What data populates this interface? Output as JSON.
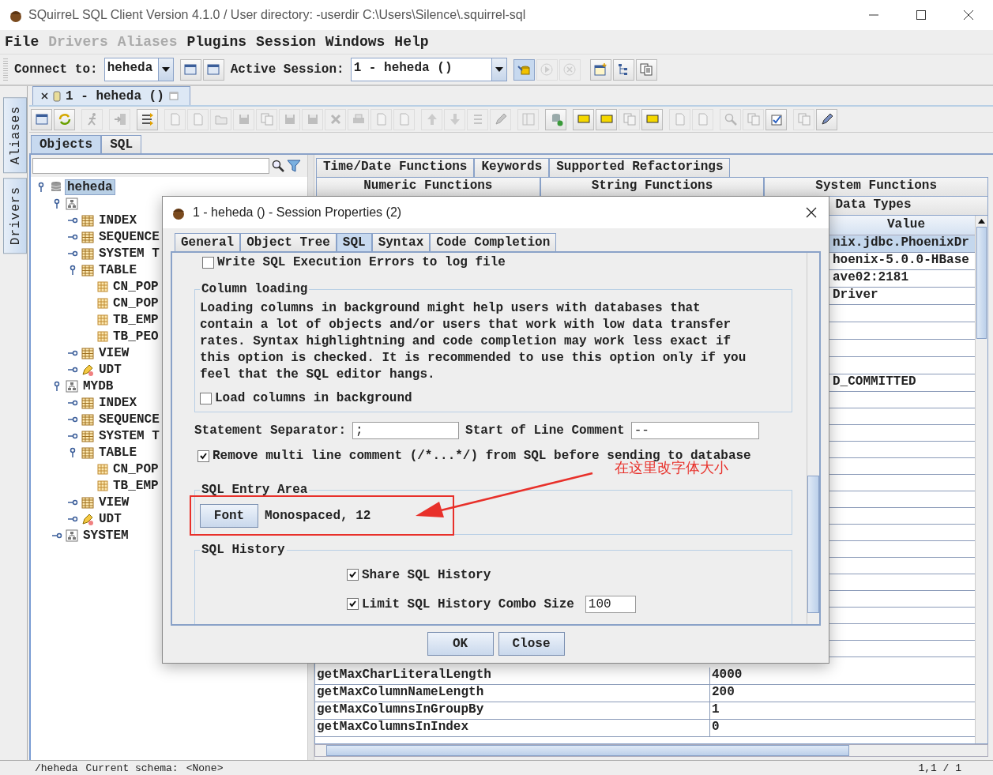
{
  "window": {
    "title": "SQuirreL SQL Client Version 4.1.0 / User directory: -userdir C:\\Users\\Silence\\.squirrel-sql"
  },
  "menu": [
    {
      "label": "File",
      "disabled": false
    },
    {
      "label": "Drivers",
      "disabled": true
    },
    {
      "label": "Aliases",
      "disabled": true
    },
    {
      "label": "Plugins",
      "disabled": false
    },
    {
      "label": "Session",
      "disabled": false
    },
    {
      "label": "Windows",
      "disabled": false
    },
    {
      "label": "Help",
      "disabled": false
    }
  ],
  "toolbar": {
    "connect_label": "Connect to:",
    "connect_value": "heheda",
    "connect_buttons": [
      {
        "disabled": false
      },
      {
        "disabled": false
      }
    ],
    "session_label": "Active Session:",
    "session_value": "1 - heheda ()",
    "session_buttons": [
      {
        "disabled": false
      },
      {
        "disabled": true
      },
      {
        "disabled": true
      },
      {
        "disabled": false
      },
      {
        "disabled": false
      },
      {
        "disabled": false
      }
    ]
  },
  "side_tabs": [
    {
      "label": "Aliases"
    },
    {
      "label": "Drivers"
    }
  ],
  "session_tab": {
    "label": "1 - heheda ()"
  },
  "session_toolbar": [
    [
      {
        "disabled": false
      },
      {
        "disabled": false
      }
    ],
    [
      {
        "disabled": true
      }
    ],
    [
      {
        "disabled": true
      }
    ],
    [
      {
        "disabled": false
      }
    ],
    [
      {
        "disabled": true
      },
      {
        "disabled": true
      },
      {
        "disabled": true
      },
      {
        "disabled": true
      },
      {
        "disabled": true
      },
      {
        "disabled": true
      },
      {
        "disabled": true
      },
      {
        "disabled": true
      },
      {
        "disabled": true
      },
      {
        "disabled": true
      },
      {
        "disabled": true
      }
    ],
    [
      {
        "disabled": true
      },
      {
        "disabled": true
      },
      {
        "disabled": true
      },
      {
        "disabled": true
      }
    ],
    [
      {
        "disabled": true
      }
    ],
    [
      {
        "disabled": false
      }
    ],
    [
      {
        "disabled": false
      },
      {
        "disabled": false
      },
      {
        "disabled": true
      },
      {
        "disabled": false
      }
    ],
    [
      {
        "disabled": true
      },
      {
        "disabled": true
      }
    ],
    [
      {
        "disabled": true
      },
      {
        "disabled": true
      },
      {
        "disabled": false
      }
    ],
    [
      {
        "disabled": true
      },
      {
        "disabled": false
      }
    ]
  ],
  "object_tabs": [
    {
      "label": "Objects",
      "selected": true
    },
    {
      "label": "SQL",
      "selected": false
    }
  ],
  "tree": [
    {
      "label": "heheda",
      "kind": "database",
      "expanded": true,
      "selected": true,
      "children": [
        {
          "kind": "schema",
          "expanded": true,
          "selected": false,
          "children": [
            {
              "label": "INDEX",
              "kind": "folder",
              "expanded": false,
              "selected": false
            },
            {
              "label": "SEQUENCE",
              "kind": "folder",
              "expanded": false,
              "selected": false
            },
            {
              "label": "SYSTEM T",
              "kind": "folder",
              "expanded": false,
              "selected": false
            },
            {
              "label": "TABLE",
              "kind": "folder",
              "expanded": true,
              "selected": false,
              "children": [
                {
                  "label": "CN_POP",
                  "kind": "table",
                  "selected": false
                },
                {
                  "label": "CN_POP",
                  "kind": "table",
                  "selected": false
                },
                {
                  "label": "TB_EMP",
                  "kind": "table",
                  "selected": false
                },
                {
                  "label": "TB_PEO",
                  "kind": "table",
                  "selected": false
                }
              ]
            },
            {
              "label": "VIEW",
              "kind": "folder",
              "expanded": false,
              "selected": false
            },
            {
              "label": "UDT",
              "kind": "udt",
              "expanded": false,
              "selected": false
            }
          ]
        },
        {
          "label": "MYDB",
          "kind": "schema",
          "expanded": true,
          "selected": false,
          "children": [
            {
              "label": "INDEX",
              "kind": "folder",
              "expanded": false,
              "selected": false
            },
            {
              "label": "SEQUENCE",
              "kind": "folder",
              "expanded": false,
              "selected": false
            },
            {
              "label": "SYSTEM T",
              "kind": "folder",
              "expanded": false,
              "selected": false
            },
            {
              "label": "TABLE",
              "kind": "folder",
              "expanded": true,
              "selected": false,
              "children": [
                {
                  "label": "CN_POP",
                  "kind": "table",
                  "selected": false
                },
                {
                  "label": "TB_EMP",
                  "kind": "table",
                  "selected": false
                }
              ]
            },
            {
              "label": "VIEW",
              "kind": "folder",
              "expanded": false,
              "selected": false
            },
            {
              "label": "UDT",
              "kind": "udt",
              "expanded": false,
              "selected": false
            }
          ]
        },
        {
          "label": "SYSTEM",
          "kind": "schema",
          "expanded": false,
          "selected": false
        }
      ]
    }
  ],
  "info_tabs": [
    [
      {
        "label": "Time/Date Functions",
        "selected": false
      },
      {
        "label": "Keywords",
        "selected": false
      },
      {
        "label": "Supported Refactorings",
        "selected": false
      }
    ],
    [
      {
        "label": "Numeric Functions",
        "selected": false
      },
      {
        "label": "String Functions",
        "selected": false
      },
      {
        "label": "System Functions",
        "selected": false
      }
    ],
    [
      {
        "label": "Data Types",
        "selected": false
      }
    ]
  ],
  "table": {
    "value_header": "Value",
    "covered_rows": [
      {
        "value": "nix.jdbc.PhoenixDr",
        "selected": true
      },
      {
        "value": "hoenix-5.0.0-HBase",
        "selected": false
      },
      {
        "value": "ave02:2181",
        "selected": false
      },
      {
        "value": "Driver",
        "selected": false
      },
      {
        "selected": false
      },
      {
        "selected": false
      },
      {
        "selected": false
      },
      {
        "selected": false
      },
      {
        "value": "D_COMMITTED",
        "selected": false
      }
    ],
    "rows": [
      {
        "name": "getMaxCharLiteralLength",
        "value": "4000"
      },
      {
        "name": "getMaxColumnNameLength",
        "value": "200"
      },
      {
        "name": "getMaxColumnsInGroupBy",
        "value": "1"
      },
      {
        "name": "getMaxColumnsInIndex",
        "value": "0"
      }
    ]
  },
  "status_bar": {
    "path": "/heheda",
    "schema_label": "Current schema:",
    "schema_value": "<None>",
    "position": "1,1 / 1"
  },
  "dialog": {
    "title": "1 - heheda () - Session Properties (2)",
    "tabs": [
      {
        "label": "General",
        "selected": false
      },
      {
        "label": "Object Tree",
        "selected": false
      },
      {
        "label": "SQL",
        "selected": true
      },
      {
        "label": "Syntax",
        "selected": false
      },
      {
        "label": "Code Completion",
        "selected": false
      }
    ],
    "write_errors": {
      "label": "Write SQL Execution Errors to log file",
      "checked": false
    },
    "column_loading": {
      "title": "Column loading",
      "description": "Loading columns in background might help users with databases that contain a lot of objects and/or users that work with low data transfer rates. Syntax highlightning and code completion may work less exact if this option is checked. It is recommended to use this option only if you feel that the SQL editor hangs.",
      "checkbox": {
        "label": "Load columns in background",
        "checked": false
      }
    },
    "separator": {
      "label": "Statement Separator:",
      "value": ";"
    },
    "line_comment": {
      "label": "Start of Line Comment",
      "value": "--"
    },
    "remove_comment": {
      "label": "Remove multi line comment (/*...*/) from SQL before sending to database",
      "checked": true
    },
    "entry_area": {
      "title": "SQL Entry Area",
      "button": "Font",
      "font": "Monospaced, 12"
    },
    "history": {
      "title": "SQL History",
      "share": {
        "label": "Share SQL History",
        "checked": true
      },
      "limit": {
        "label": "Limit SQL History Combo Size",
        "checked": true,
        "value": "100"
      }
    },
    "buttons": [
      "OK",
      "Close"
    ]
  },
  "annotation": {
    "note": "在这里改字体大小"
  }
}
